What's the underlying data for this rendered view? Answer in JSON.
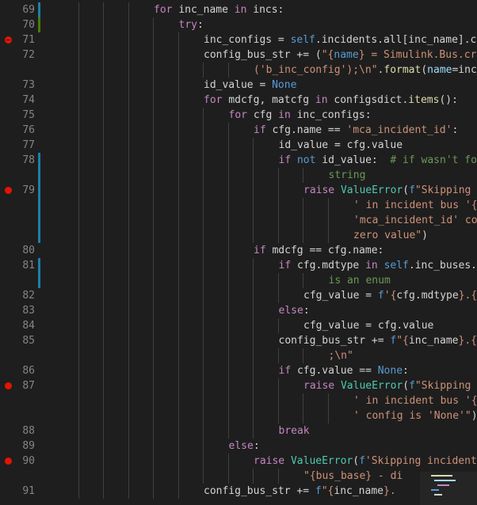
{
  "editor": {
    "lines": [
      {
        "number": "69",
        "bp": false,
        "change": "#1b81a8",
        "indent": 4,
        "tokens": [
          [
            "kw",
            "for "
          ],
          [
            "txt",
            "inc_name "
          ],
          [
            "kw",
            "in "
          ],
          [
            "txt",
            "incs:"
          ]
        ]
      },
      {
        "number": "70",
        "bp": false,
        "change": "#487e02",
        "indent": 5,
        "tokens": [
          [
            "kw",
            "try"
          ],
          [
            "txt",
            ":"
          ]
        ]
      },
      {
        "number": "71",
        "bp": true,
        "cond": true,
        "change": "",
        "indent": 6,
        "tokens": [
          [
            "txt",
            "inc_configs = "
          ],
          [
            "def",
            "self"
          ],
          [
            "txt",
            ".incidents.all[inc_name].co"
          ]
        ]
      },
      {
        "number": "72",
        "bp": false,
        "change": "",
        "indent": 6,
        "tokens": [
          [
            "txt",
            "config_bus_str += ("
          ],
          [
            "str",
            "\"{"
          ],
          [
            "def",
            "name"
          ],
          [
            "str",
            "} = Simulink.Bus.cre"
          ]
        ]
      },
      {
        "number": "",
        "bp": false,
        "change": "",
        "indent": 8,
        "tokens": [
          [
            "str",
            "('b_inc_config');\\n\""
          ],
          [
            "txt",
            "."
          ],
          [
            "fn",
            "format"
          ],
          [
            "txt",
            "("
          ],
          [
            "var",
            "name"
          ],
          [
            "txt",
            "=inc_"
          ]
        ]
      },
      {
        "number": "73",
        "bp": false,
        "change": "",
        "indent": 6,
        "tokens": [
          [
            "txt",
            "id_value = "
          ],
          [
            "def",
            "None"
          ]
        ]
      },
      {
        "number": "74",
        "bp": false,
        "change": "",
        "indent": 6,
        "tokens": [
          [
            "kw",
            "for "
          ],
          [
            "txt",
            "mdcfg, matcfg "
          ],
          [
            "kw",
            "in "
          ],
          [
            "txt",
            "configsdict."
          ],
          [
            "fn",
            "items"
          ],
          [
            "txt",
            "():"
          ]
        ]
      },
      {
        "number": "75",
        "bp": false,
        "change": "",
        "indent": 7,
        "tokens": [
          [
            "kw",
            "for "
          ],
          [
            "txt",
            "cfg "
          ],
          [
            "kw",
            "in "
          ],
          [
            "txt",
            "inc_configs:"
          ]
        ]
      },
      {
        "number": "76",
        "bp": false,
        "change": "",
        "indent": 8,
        "tokens": [
          [
            "kw",
            "if "
          ],
          [
            "txt",
            "cfg.name == "
          ],
          [
            "str",
            "'mca_incident_id'"
          ],
          [
            "txt",
            ":"
          ]
        ]
      },
      {
        "number": "77",
        "bp": false,
        "change": "",
        "indent": 9,
        "tokens": [
          [
            "txt",
            "id_value = cfg.value"
          ]
        ]
      },
      {
        "number": "78",
        "bp": false,
        "change": "#1b81a8",
        "indent": 9,
        "tokens": [
          [
            "kw",
            "if "
          ],
          [
            "def",
            "not "
          ],
          [
            "txt",
            "id_value:  "
          ],
          [
            "com",
            "# if wasn't fou"
          ]
        ]
      },
      {
        "number": "",
        "bp": false,
        "change": "#1b81a8",
        "indent": 11,
        "tokens": [
          [
            "com",
            "string"
          ]
        ]
      },
      {
        "number": "79",
        "bp": true,
        "cond": false,
        "change": "#1b81a8",
        "indent": 10,
        "tokens": [
          [
            "kw",
            "raise "
          ],
          [
            "cls",
            "ValueError"
          ],
          [
            "txt",
            "("
          ],
          [
            "def",
            "f"
          ],
          [
            "str",
            "\"Skipping i"
          ]
        ]
      },
      {
        "number": "",
        "bp": false,
        "change": "#1b81a8",
        "indent": 12,
        "tokens": [
          [
            "str",
            "' in incident bus '{bu"
          ]
        ]
      },
      {
        "number": "",
        "bp": false,
        "change": "#1b81a8",
        "indent": 12,
        "tokens": [
          [
            "str",
            "'mca_incident_id' con"
          ]
        ]
      },
      {
        "number": "",
        "bp": false,
        "change": "#1b81a8",
        "indent": 12,
        "tokens": [
          [
            "str",
            "zero value\""
          ],
          [
            "txt",
            ")"
          ]
        ]
      },
      {
        "number": "80",
        "bp": false,
        "change": "",
        "indent": 8,
        "tokens": [
          [
            "kw",
            "if "
          ],
          [
            "txt",
            "mdcfg == cfg.name:"
          ]
        ]
      },
      {
        "number": "81",
        "bp": false,
        "change": "#1b81a8",
        "indent": 9,
        "tokens": [
          [
            "kw",
            "if "
          ],
          [
            "txt",
            "cfg.mdtype "
          ],
          [
            "kw",
            "in "
          ],
          [
            "def",
            "self"
          ],
          [
            "txt",
            ".inc_buses.e"
          ]
        ]
      },
      {
        "number": "",
        "bp": false,
        "change": "#1b81a8",
        "indent": 11,
        "tokens": [
          [
            "com",
            "is an enum"
          ]
        ]
      },
      {
        "number": "82",
        "bp": false,
        "change": "",
        "indent": 10,
        "tokens": [
          [
            "txt",
            "cfg_value = "
          ],
          [
            "def",
            "f"
          ],
          [
            "str",
            "'{"
          ],
          [
            "txt",
            "cfg.mdtype"
          ],
          [
            "str",
            "}.{c"
          ]
        ]
      },
      {
        "number": "83",
        "bp": false,
        "change": "",
        "indent": 9,
        "tokens": [
          [
            "kw",
            "else"
          ],
          [
            "txt",
            ":"
          ]
        ]
      },
      {
        "number": "84",
        "bp": false,
        "change": "",
        "indent": 10,
        "tokens": [
          [
            "txt",
            "cfg_value = cfg.value"
          ]
        ]
      },
      {
        "number": "85",
        "bp": false,
        "change": "",
        "indent": 9,
        "tokens": [
          [
            "txt",
            "config_bus_str += "
          ],
          [
            "def",
            "f"
          ],
          [
            "str",
            "\"{"
          ],
          [
            "txt",
            "inc_name"
          ],
          [
            "str",
            "}.{ma"
          ]
        ]
      },
      {
        "number": "",
        "bp": false,
        "change": "",
        "indent": 11,
        "tokens": [
          [
            "str",
            ";\\n\""
          ]
        ]
      },
      {
        "number": "86",
        "bp": false,
        "change": "",
        "indent": 9,
        "tokens": [
          [
            "kw",
            "if "
          ],
          [
            "txt",
            "cfg.value == "
          ],
          [
            "def",
            "None"
          ],
          [
            "txt",
            ":"
          ]
        ]
      },
      {
        "number": "87",
        "bp": true,
        "cond": false,
        "change": "",
        "indent": 10,
        "tokens": [
          [
            "kw",
            "raise "
          ],
          [
            "cls",
            "ValueError"
          ],
          [
            "txt",
            "("
          ],
          [
            "def",
            "f"
          ],
          [
            "str",
            "\"Skipping i"
          ]
        ]
      },
      {
        "number": "",
        "bp": false,
        "change": "",
        "indent": 12,
        "tokens": [
          [
            "str",
            "' in incident bus '{bu"
          ]
        ]
      },
      {
        "number": "",
        "bp": false,
        "change": "",
        "indent": 12,
        "tokens": [
          [
            "str",
            "' config is 'None'\""
          ],
          [
            "txt",
            ")"
          ]
        ]
      },
      {
        "number": "88",
        "bp": false,
        "change": "",
        "indent": 9,
        "tokens": [
          [
            "kw",
            "break"
          ]
        ]
      },
      {
        "number": "89",
        "bp": false,
        "change": "",
        "indent": 7,
        "tokens": [
          [
            "kw",
            "else"
          ],
          [
            "txt",
            ":"
          ]
        ]
      },
      {
        "number": "90",
        "bp": true,
        "cond": false,
        "change": "",
        "indent": 8,
        "tokens": [
          [
            "kw",
            "raise "
          ],
          [
            "cls",
            "ValueError"
          ],
          [
            "txt",
            "("
          ],
          [
            "def",
            "f"
          ],
          [
            "str",
            "'Skipping incident "
          ]
        ]
      },
      {
        "number": "",
        "bp": false,
        "change": "",
        "indent": 10,
        "tokens": [
          [
            "str",
            "\"{bus_base} - di"
          ]
        ]
      },
      {
        "number": "91",
        "bp": false,
        "change": "",
        "indent": 6,
        "tokens": [
          [
            "txt",
            "config_bus_str += "
          ],
          [
            "def",
            "f"
          ],
          [
            "str",
            "\"{"
          ],
          [
            "txt",
            "inc_name"
          ],
          [
            "str",
            "}."
          ]
        ]
      }
    ]
  },
  "colors": {
    "background": "#1e1e1e",
    "breakpoint": "#e51400",
    "line_number": "#858585",
    "change_modified": "#1b81a8",
    "change_added": "#487e02"
  },
  "minimap": {
    "lines": [
      {
        "text": "write_inc",
        "color": "#dcdcaa"
      },
      {
        "text": "with self",
        "color": "#9cdcfe"
      },
      {
        "text": "for b",
        "color": "#c586c0"
      },
      {
        "text": "",
        "color": "#569cd6"
      },
      {
        "text": "",
        "color": "#d4d4d4"
      }
    ]
  }
}
